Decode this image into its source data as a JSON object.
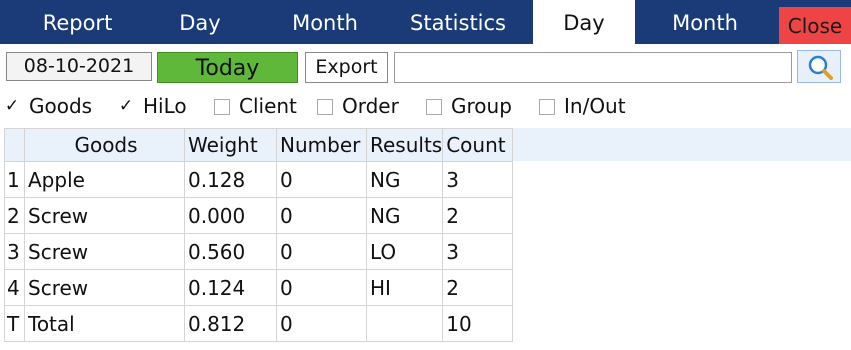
{
  "tabs": {
    "report": "Report",
    "day": "Day",
    "month": "Month",
    "statistics": "Statistics",
    "day_selected": "Day",
    "month2": "Month",
    "close": "Close"
  },
  "toolbar": {
    "date": "08-10-2021",
    "today": "Today",
    "export": "Export",
    "search_value": "",
    "search_icon": "magnifier-icon"
  },
  "filters": [
    {
      "label": "Goods",
      "checked": true
    },
    {
      "label": "HiLo",
      "checked": true
    },
    {
      "label": "Client",
      "checked": false
    },
    {
      "label": "Order",
      "checked": false
    },
    {
      "label": "Group",
      "checked": false
    },
    {
      "label": "In/Out",
      "checked": false
    }
  ],
  "table": {
    "headers": {
      "idx": "",
      "goods": "Goods",
      "weight": "Weight",
      "number": "Number",
      "result": "Results",
      "count": "Count"
    },
    "rows": [
      {
        "idx": "1",
        "goods": "Apple",
        "weight": "0.128",
        "number": "0",
        "result": "NG",
        "count": "3"
      },
      {
        "idx": "2",
        "goods": "Screw",
        "weight": "0.000",
        "number": "0",
        "result": "NG",
        "count": "2"
      },
      {
        "idx": "3",
        "goods": "Screw",
        "weight": "0.560",
        "number": "0",
        "result": "LO",
        "count": "3"
      },
      {
        "idx": "4",
        "goods": "Screw",
        "weight": "0.124",
        "number": "0",
        "result": "HI",
        "count": "2"
      },
      {
        "idx": "T",
        "goods": "Total",
        "weight": "0.812",
        "number": "0",
        "result": "",
        "count": "10"
      }
    ]
  },
  "colors": {
    "tabbar": "#1a3a78",
    "close": "#ef4444",
    "today": "#5fb83a",
    "header_row": "#e9f1fb"
  }
}
